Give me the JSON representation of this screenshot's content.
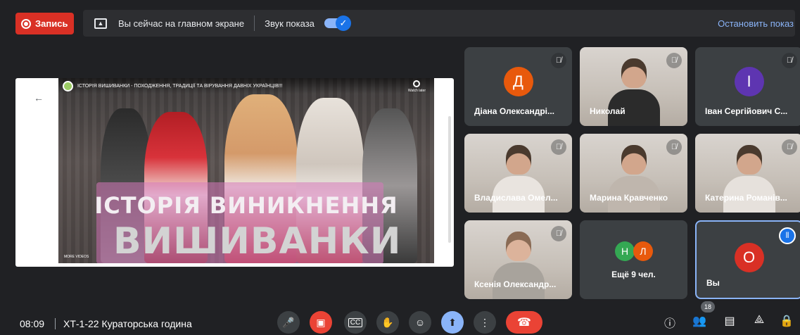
{
  "topbar": {
    "record_label": "Запись",
    "presenting_text": "Вы сейчас на главном экране",
    "sound_label": "Звук показа",
    "sound_toggle_on": true,
    "stop_label": "Остановить показ"
  },
  "presentation": {
    "video_title": "ІСТОРІЯ ВИШИВАНКИ - ПОХОДЖЕННЯ, ТРАДИЦІЇ ТА ВІРУВАННЯ ДАВНІХ УКРАЇНЦІВ!!!",
    "watch_later": "Watch later",
    "headline_1": "ІСТОРІЯ ВИНИКНЕННЯ",
    "headline_2": "ВИШИВАНКИ",
    "more_videos": "MORE VIDEOS"
  },
  "participants": [
    {
      "name": "Діана Олександрі...",
      "initial": "Д",
      "avatar_color": "#e8590c",
      "has_video": false
    },
    {
      "name": "Николай",
      "has_video": true
    },
    {
      "name": "Іван Сергійович С...",
      "initial": "І",
      "avatar_color": "#5e35b1",
      "has_video": false
    },
    {
      "name": "Владислава Омел...",
      "has_video": true
    },
    {
      "name": "Марина Кравченко",
      "has_video": true
    },
    {
      "name": "Катерина Романів...",
      "has_video": true
    },
    {
      "name": "Ксенія Олександр...",
      "has_video": true
    }
  ],
  "more_tile": {
    "label": "Ещё 9 чел.",
    "initials": [
      "Н",
      "Л"
    ],
    "colors": [
      "#34a853",
      "#e8590c"
    ]
  },
  "self_tile": {
    "name": "Вы",
    "initial": "О",
    "avatar_color": "#d93025"
  },
  "bottombar": {
    "time": "08:09",
    "meeting_name": "ХТ-1-22 Кураторська година",
    "participants_count": "18"
  }
}
